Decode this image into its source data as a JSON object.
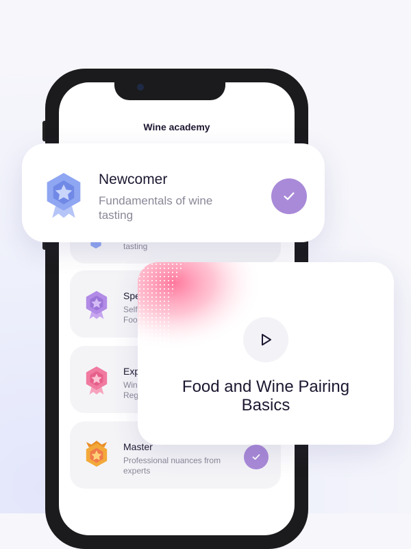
{
  "app": {
    "title": "Wine academy"
  },
  "levels": [
    {
      "title": "Newcomer",
      "description": "Fundamentals of wine tasting",
      "completed": true,
      "badge_color": "#8fa6f2"
    },
    {
      "title": "Spe",
      "description": "Self Foo",
      "completed": false,
      "badge_color": "#b18be6"
    },
    {
      "title": "Exp",
      "description": "Win Reg",
      "completed": false,
      "badge_color": "#f07aa0"
    },
    {
      "title": "Master",
      "description": "Professional nuances from experts",
      "completed": true,
      "badge_color": "#f3a93a"
    }
  ],
  "behind_card": {
    "description_fragment": "tasting"
  },
  "featured": {
    "newcomer": {
      "title": "Newcomer",
      "description": "Fundamentals of wine tasting"
    },
    "video": {
      "title": "Food and Wine Pairing Basics",
      "icon": "play-icon"
    }
  },
  "colors": {
    "accent": "#a98ad8",
    "text": "#1d1730",
    "muted": "#8a8797",
    "card_bg": "#f4f4f7"
  }
}
